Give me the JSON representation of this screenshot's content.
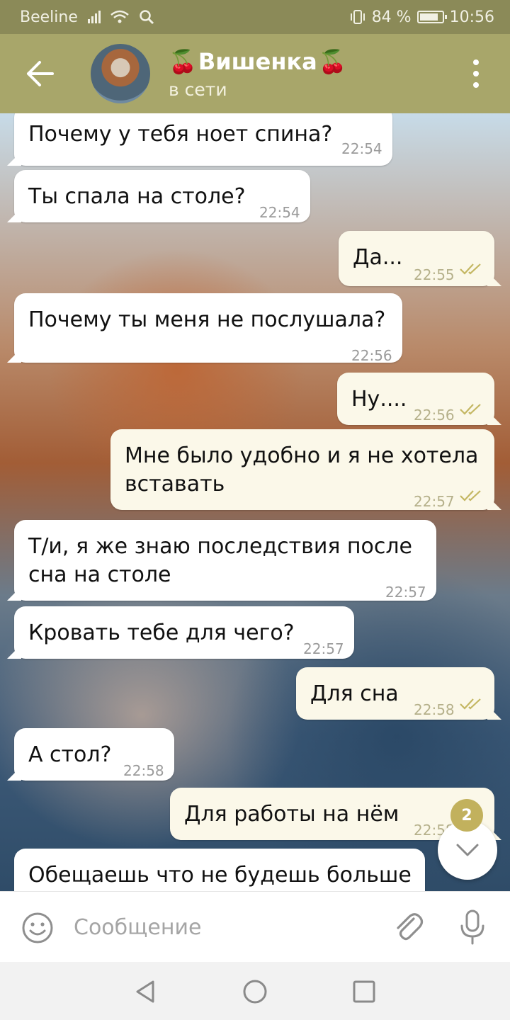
{
  "status_bar": {
    "carrier": "Beeline",
    "battery": "84 %",
    "time": "10:56",
    "battery_level": 0.84
  },
  "header": {
    "title": "Вишенка",
    "title_emoji_left": "🍒",
    "title_emoji_right": "🍒",
    "status": "в сети"
  },
  "messages": [
    {
      "dir": "in",
      "text": "Почему у тебя ноет спина?",
      "time": "22:54"
    },
    {
      "dir": "in",
      "text": "Ты спала на столе?",
      "time": "22:54"
    },
    {
      "dir": "out",
      "text": "Да...",
      "time": "22:55",
      "read": true
    },
    {
      "dir": "in",
      "text": "Почему ты меня не послушала?",
      "time": "22:56"
    },
    {
      "dir": "out",
      "text": "Ну....",
      "time": "22:56",
      "read": true
    },
    {
      "dir": "out",
      "text": "Мне было удобно и я не хотела вставать",
      "time": "22:57",
      "read": true
    },
    {
      "dir": "in",
      "text": "Т/и, я же знаю последствия после сна на столе",
      "time": "22:57"
    },
    {
      "dir": "in",
      "text": "Кровать тебе для чего?",
      "time": "22:57"
    },
    {
      "dir": "out",
      "text": "Для сна",
      "time": "22:58",
      "read": true
    },
    {
      "dir": "in",
      "text": "А стол?",
      "time": "22:58"
    },
    {
      "dir": "out",
      "text": "Для работы на нём",
      "time": "22:58",
      "read": true
    },
    {
      "dir": "in",
      "text": "Обещаешь что не будешь больше"
    }
  ],
  "unread_count": "2",
  "input": {
    "placeholder": "Сообщение"
  },
  "colors": {
    "header": "#a8a66a",
    "status_bar": "#8b8a58",
    "outgoing_bubble": "#fbf8e9",
    "incoming_bubble": "#ffffff",
    "badge": "#c2b15d"
  },
  "icons": [
    "back-arrow-icon",
    "more-vert-icon",
    "emoji-icon",
    "attach-icon",
    "mic-icon",
    "chevron-down-icon",
    "nav-back-icon",
    "nav-home-icon",
    "nav-recents-icon",
    "double-check-icon"
  ]
}
